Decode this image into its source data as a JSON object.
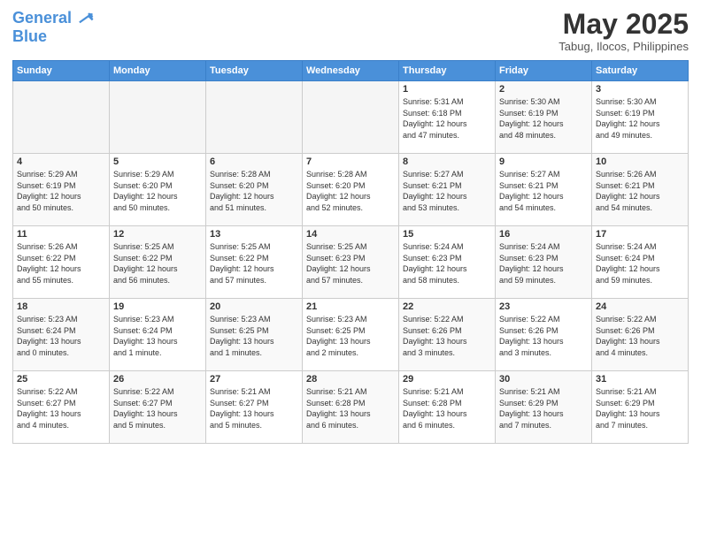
{
  "header": {
    "logo_line1": "General",
    "logo_line2": "Blue",
    "month": "May 2025",
    "location": "Tabug, Ilocos, Philippines"
  },
  "weekdays": [
    "Sunday",
    "Monday",
    "Tuesday",
    "Wednesday",
    "Thursday",
    "Friday",
    "Saturday"
  ],
  "weeks": [
    [
      {
        "day": "",
        "info": ""
      },
      {
        "day": "",
        "info": ""
      },
      {
        "day": "",
        "info": ""
      },
      {
        "day": "",
        "info": ""
      },
      {
        "day": "1",
        "info": "Sunrise: 5:31 AM\nSunset: 6:18 PM\nDaylight: 12 hours\nand 47 minutes."
      },
      {
        "day": "2",
        "info": "Sunrise: 5:30 AM\nSunset: 6:19 PM\nDaylight: 12 hours\nand 48 minutes."
      },
      {
        "day": "3",
        "info": "Sunrise: 5:30 AM\nSunset: 6:19 PM\nDaylight: 12 hours\nand 49 minutes."
      }
    ],
    [
      {
        "day": "4",
        "info": "Sunrise: 5:29 AM\nSunset: 6:19 PM\nDaylight: 12 hours\nand 50 minutes."
      },
      {
        "day": "5",
        "info": "Sunrise: 5:29 AM\nSunset: 6:20 PM\nDaylight: 12 hours\nand 50 minutes."
      },
      {
        "day": "6",
        "info": "Sunrise: 5:28 AM\nSunset: 6:20 PM\nDaylight: 12 hours\nand 51 minutes."
      },
      {
        "day": "7",
        "info": "Sunrise: 5:28 AM\nSunset: 6:20 PM\nDaylight: 12 hours\nand 52 minutes."
      },
      {
        "day": "8",
        "info": "Sunrise: 5:27 AM\nSunset: 6:21 PM\nDaylight: 12 hours\nand 53 minutes."
      },
      {
        "day": "9",
        "info": "Sunrise: 5:27 AM\nSunset: 6:21 PM\nDaylight: 12 hours\nand 54 minutes."
      },
      {
        "day": "10",
        "info": "Sunrise: 5:26 AM\nSunset: 6:21 PM\nDaylight: 12 hours\nand 54 minutes."
      }
    ],
    [
      {
        "day": "11",
        "info": "Sunrise: 5:26 AM\nSunset: 6:22 PM\nDaylight: 12 hours\nand 55 minutes."
      },
      {
        "day": "12",
        "info": "Sunrise: 5:25 AM\nSunset: 6:22 PM\nDaylight: 12 hours\nand 56 minutes."
      },
      {
        "day": "13",
        "info": "Sunrise: 5:25 AM\nSunset: 6:22 PM\nDaylight: 12 hours\nand 57 minutes."
      },
      {
        "day": "14",
        "info": "Sunrise: 5:25 AM\nSunset: 6:23 PM\nDaylight: 12 hours\nand 57 minutes."
      },
      {
        "day": "15",
        "info": "Sunrise: 5:24 AM\nSunset: 6:23 PM\nDaylight: 12 hours\nand 58 minutes."
      },
      {
        "day": "16",
        "info": "Sunrise: 5:24 AM\nSunset: 6:23 PM\nDaylight: 12 hours\nand 59 minutes."
      },
      {
        "day": "17",
        "info": "Sunrise: 5:24 AM\nSunset: 6:24 PM\nDaylight: 12 hours\nand 59 minutes."
      }
    ],
    [
      {
        "day": "18",
        "info": "Sunrise: 5:23 AM\nSunset: 6:24 PM\nDaylight: 13 hours\nand 0 minutes."
      },
      {
        "day": "19",
        "info": "Sunrise: 5:23 AM\nSunset: 6:24 PM\nDaylight: 13 hours\nand 1 minute."
      },
      {
        "day": "20",
        "info": "Sunrise: 5:23 AM\nSunset: 6:25 PM\nDaylight: 13 hours\nand 1 minutes."
      },
      {
        "day": "21",
        "info": "Sunrise: 5:23 AM\nSunset: 6:25 PM\nDaylight: 13 hours\nand 2 minutes."
      },
      {
        "day": "22",
        "info": "Sunrise: 5:22 AM\nSunset: 6:26 PM\nDaylight: 13 hours\nand 3 minutes."
      },
      {
        "day": "23",
        "info": "Sunrise: 5:22 AM\nSunset: 6:26 PM\nDaylight: 13 hours\nand 3 minutes."
      },
      {
        "day": "24",
        "info": "Sunrise: 5:22 AM\nSunset: 6:26 PM\nDaylight: 13 hours\nand 4 minutes."
      }
    ],
    [
      {
        "day": "25",
        "info": "Sunrise: 5:22 AM\nSunset: 6:27 PM\nDaylight: 13 hours\nand 4 minutes."
      },
      {
        "day": "26",
        "info": "Sunrise: 5:22 AM\nSunset: 6:27 PM\nDaylight: 13 hours\nand 5 minutes."
      },
      {
        "day": "27",
        "info": "Sunrise: 5:21 AM\nSunset: 6:27 PM\nDaylight: 13 hours\nand 5 minutes."
      },
      {
        "day": "28",
        "info": "Sunrise: 5:21 AM\nSunset: 6:28 PM\nDaylight: 13 hours\nand 6 minutes."
      },
      {
        "day": "29",
        "info": "Sunrise: 5:21 AM\nSunset: 6:28 PM\nDaylight: 13 hours\nand 6 minutes."
      },
      {
        "day": "30",
        "info": "Sunrise: 5:21 AM\nSunset: 6:29 PM\nDaylight: 13 hours\nand 7 minutes."
      },
      {
        "day": "31",
        "info": "Sunrise: 5:21 AM\nSunset: 6:29 PM\nDaylight: 13 hours\nand 7 minutes."
      }
    ]
  ]
}
